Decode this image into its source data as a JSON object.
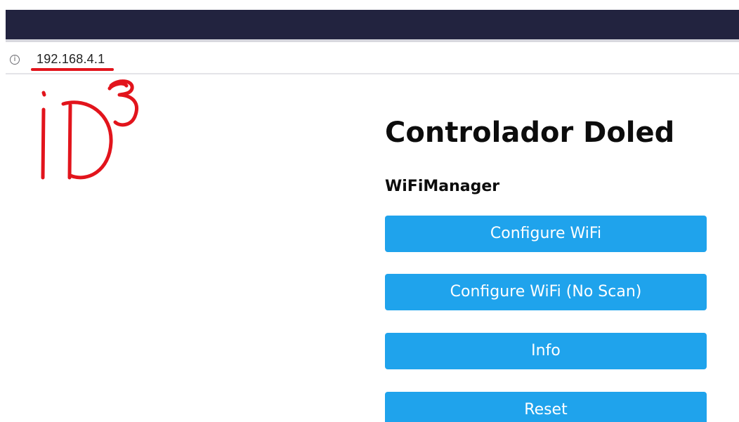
{
  "browser": {
    "address": "192.168.4.1",
    "info_icon": "info-icon"
  },
  "annotation": {
    "handwritten_text": "iD",
    "superscript": "3",
    "color": "#e2141c"
  },
  "page": {
    "title": "Controlador Doled",
    "subtitle": "WiFiManager",
    "buttons": [
      {
        "label": "Configure WiFi"
      },
      {
        "label": "Configure WiFi (No Scan)"
      },
      {
        "label": "Info"
      },
      {
        "label": "Reset"
      }
    ]
  },
  "colors": {
    "tab_bar": "#22233f",
    "button": "#1fa3ec",
    "button_text": "#ffffff"
  }
}
